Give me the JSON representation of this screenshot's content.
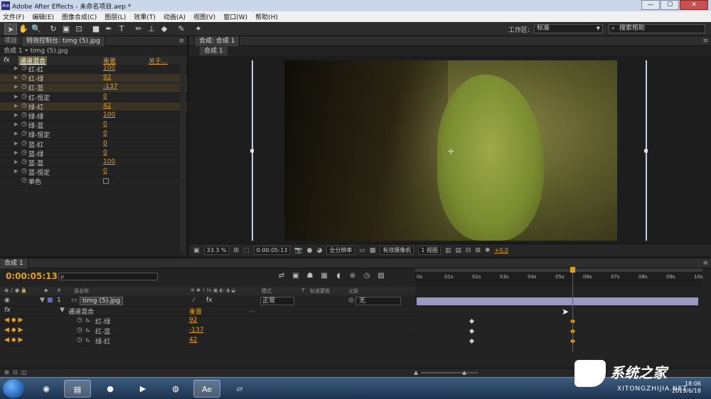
{
  "window": {
    "app_badge": "Ae",
    "title": "Adobe After Effects - 未命名项目.aep *",
    "buttons": [
      "—",
      "☐",
      "✕"
    ]
  },
  "menu": [
    "文件(F)",
    "编辑(E)",
    "图像合成(C)",
    "图层(L)",
    "效果(T)",
    "动画(A)",
    "视图(V)",
    "窗口(W)",
    "帮助(H)"
  ],
  "toolbar": {
    "workspace_label": "工作区:",
    "workspace_value": "标准",
    "search_placeholder": "搜索帮助"
  },
  "effects_panel": {
    "tabs": [
      "项目",
      "特效控制台: timg (5).jpg"
    ],
    "breadcrumb": "合成 1 • timg (5).jpg",
    "fx_badge": "fx",
    "effect_name": "通道混合",
    "reset": "重置",
    "about": "关于...",
    "properties": [
      {
        "label": "红-红",
        "value": "100",
        "highlight": false
      },
      {
        "label": "红-绿",
        "value": "92",
        "highlight": true
      },
      {
        "label": "红-蓝",
        "value": "-137",
        "highlight": true
      },
      {
        "label": "红-恒定",
        "value": "0",
        "highlight": false
      },
      {
        "label": "绿-红",
        "value": "42",
        "highlight": true
      },
      {
        "label": "绿-绿",
        "value": "100",
        "highlight": false
      },
      {
        "label": "绿-蓝",
        "value": "0",
        "highlight": false
      },
      {
        "label": "绿-恒定",
        "value": "0",
        "highlight": false
      },
      {
        "label": "蓝-红",
        "value": "0",
        "highlight": false
      },
      {
        "label": "蓝-绿",
        "value": "0",
        "highlight": false
      },
      {
        "label": "蓝-蓝",
        "value": "100",
        "highlight": false
      },
      {
        "label": "蓝-恒定",
        "value": "0",
        "highlight": false
      }
    ],
    "monochrome_label": "单色"
  },
  "composition": {
    "tab": "合成: 合成 1",
    "subtab": "合成 1",
    "zoom": "33.3 %",
    "timecode": "0:00:05:13",
    "resolution": "全分辨率",
    "camera": "有效摄像机",
    "views": "1 视图",
    "exposure": "+0.0"
  },
  "timeline": {
    "tab": "合成 1",
    "timecode": "0:00:05:13",
    "search_placeholder": "ρ",
    "ruler_ticks": [
      "0s",
      "01s",
      "02s",
      "03s",
      "04s",
      "05s",
      "06s",
      "07s",
      "08s",
      "09s",
      "10s"
    ],
    "columns": {
      "source": "源名称",
      "mode": "模式",
      "t": "T",
      "trkmat": "轨道蒙板",
      "parent": "父级"
    },
    "layer": {
      "index": "1",
      "name": "timg (5).jpg",
      "mode": "正常",
      "parent": "无"
    },
    "effect_row": {
      "fx": "fx",
      "name": "通道混合",
      "reset": "重置",
      "dots": "..."
    },
    "keyed_props": [
      {
        "label": "红-绿",
        "value": "92"
      },
      {
        "label": "红-蓝",
        "value": "-137"
      },
      {
        "label": "绿-红",
        "value": "42"
      }
    ],
    "current_time_fraction": 0.553
  },
  "watermark": {
    "brand": "系统之家",
    "url": "XITONGZHIJIA.NET"
  },
  "clock": {
    "time": "18:06",
    "date": "2019/6/18"
  }
}
